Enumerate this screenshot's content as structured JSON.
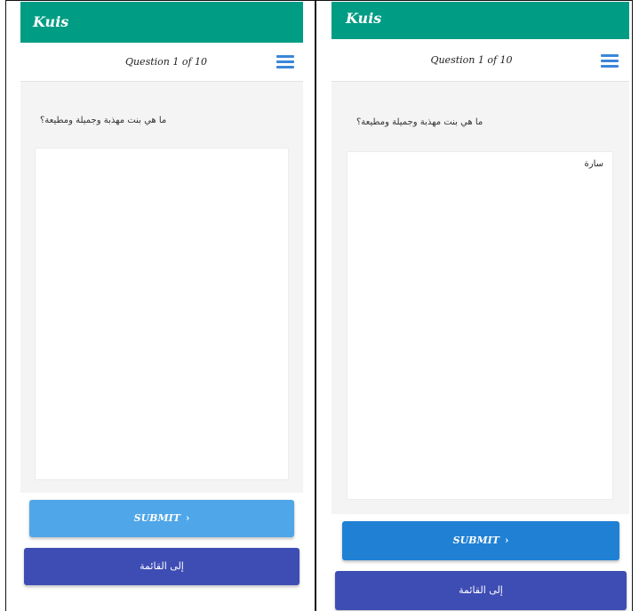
{
  "screens": [
    {
      "app_title": "Kuis",
      "question_counter": "Question 1 of 10",
      "question_text": "ما هي بنت مهذبة وجميلة ومطيعة؟",
      "answer_value": "",
      "submit_label": "SUBMIT",
      "submit_icon": "›",
      "back_label": "إلى القائمة"
    },
    {
      "app_title": "Kuis",
      "question_counter": "Question 1 of 10",
      "question_text": "ما هي بنت مهذبة وجميلة ومطيعة؟",
      "answer_value": "سارة",
      "submit_label": "SUBMIT",
      "submit_icon": "›",
      "back_label": "إلى القائمة"
    }
  ],
  "colors": {
    "appbar": "#009c84",
    "submit_light": "#4fa6e8",
    "submit_dark": "#2081d4",
    "back_button": "#3e4db4",
    "menu_icon": "#3b86d8"
  }
}
